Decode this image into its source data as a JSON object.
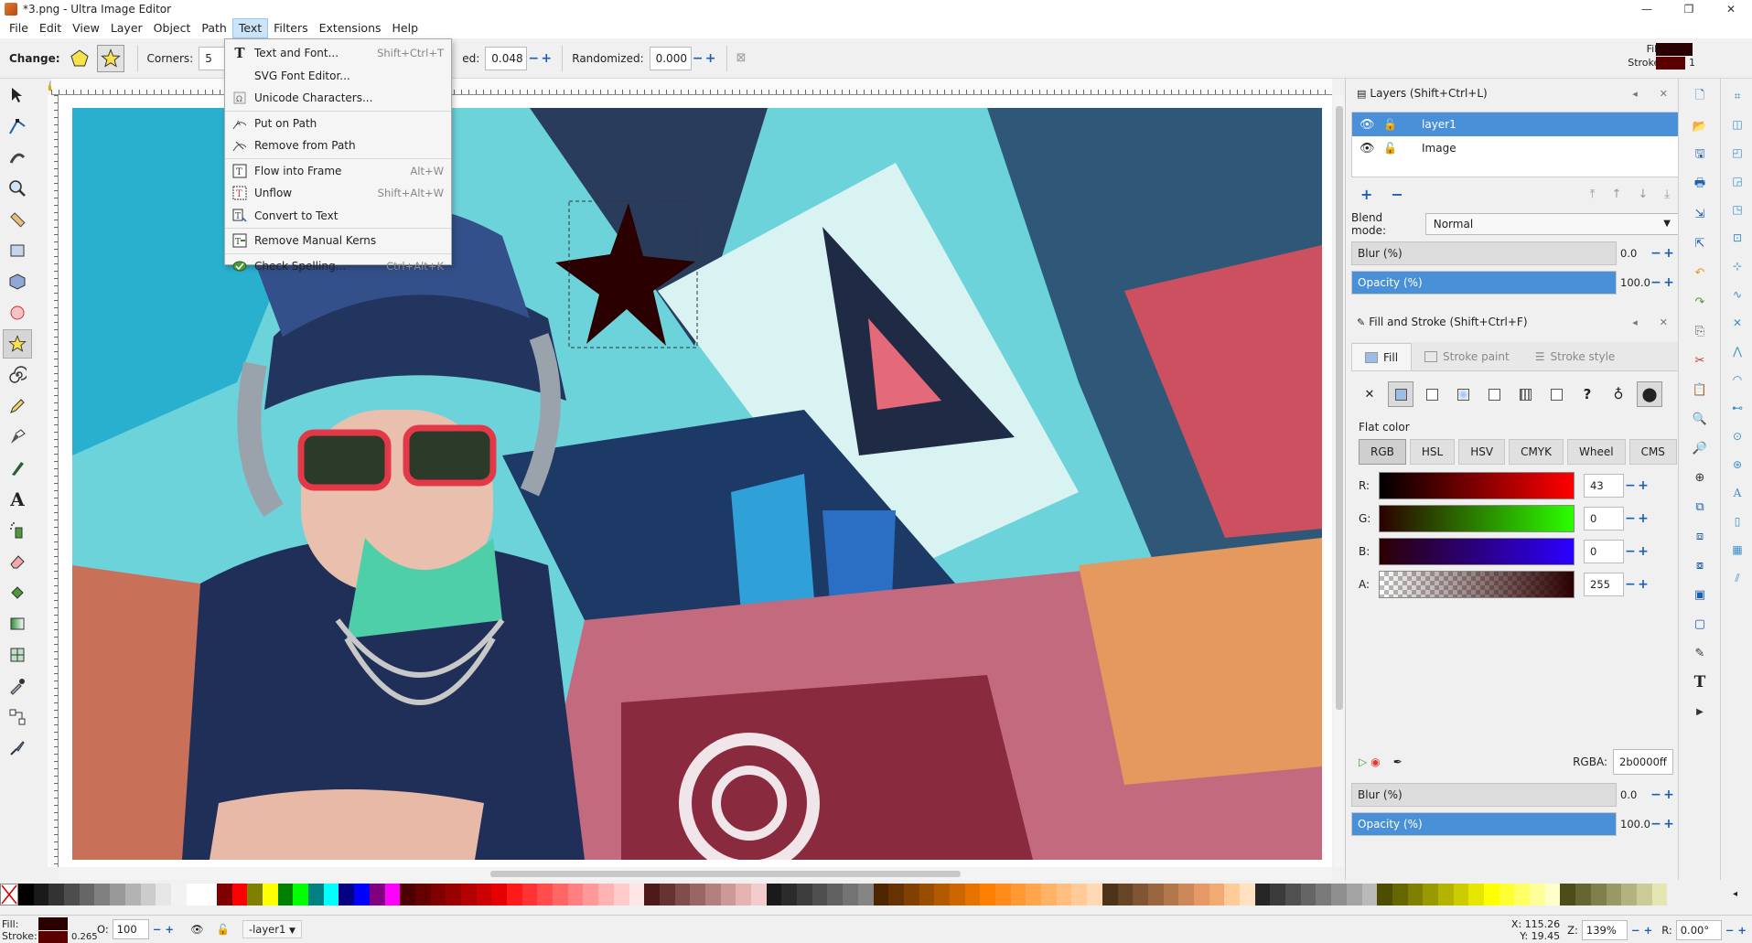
{
  "window": {
    "title": "*3.png - Ultra Image Editor",
    "min": "—",
    "max": "❐",
    "close": "✕"
  },
  "menubar": [
    "File",
    "Edit",
    "View",
    "Layer",
    "Object",
    "Path",
    "Text",
    "Filters",
    "Extensions",
    "Help"
  ],
  "controls": {
    "change_label": "Change:",
    "corners_label": "Corners:",
    "corners_value": "5",
    "rounded_label": "ed:",
    "rounded_value": "0.048",
    "randomized_label": "Randomized:",
    "randomized_value": "0.000",
    "fill_label": "Fill:",
    "stroke_label": "Stroke:",
    "stroke_value": "1"
  },
  "text_menu": [
    {
      "label": "Text and Font...",
      "shortcut": "Shift+Ctrl+T",
      "icon": "text-tool-icon"
    },
    {
      "label": "SVG Font Editor...",
      "shortcut": "",
      "icon": ""
    },
    {
      "label": "Unicode Characters...",
      "shortcut": "",
      "icon": "unicode-icon"
    },
    {
      "label": "Put on Path",
      "shortcut": "",
      "icon": "put-on-path-icon"
    },
    {
      "label": "Remove from Path",
      "shortcut": "",
      "icon": "remove-from-path-icon"
    },
    {
      "label": "Flow into Frame",
      "shortcut": "Alt+W",
      "icon": "flow-into-frame-icon"
    },
    {
      "label": "Unflow",
      "shortcut": "Shift+Alt+W",
      "icon": "unflow-icon"
    },
    {
      "label": "Convert to Text",
      "shortcut": "",
      "icon": "convert-to-text-icon"
    },
    {
      "label": "Remove Manual Kerns",
      "shortcut": "",
      "icon": "remove-kerns-icon"
    },
    {
      "label": "Check Spelling...",
      "shortcut": "Ctrl+Alt+K",
      "icon": "spellcheck-icon"
    }
  ],
  "layers_panel": {
    "title": "Layers (Shift+Ctrl+L)",
    "layers": [
      "layer1",
      "Image"
    ],
    "blend_label": "Blend mode:",
    "blend_value": "Normal",
    "blur_label": "Blur (%)",
    "blur_value": "0.0",
    "opacity_label": "Opacity (%)",
    "opacity_value": "100.0",
    "opacity_fraction": 1.0
  },
  "fill_stroke_panel": {
    "title": "Fill and Stroke (Shift+Ctrl+F)",
    "tabs": [
      "Fill",
      "Stroke paint",
      "Stroke style"
    ],
    "flat_color_label": "Flat color",
    "modes": [
      "RGB",
      "HSL",
      "HSV",
      "CMYK",
      "Wheel",
      "CMS"
    ],
    "channels": [
      {
        "label": "R:",
        "value": "43"
      },
      {
        "label": "G:",
        "value": "0"
      },
      {
        "label": "B:",
        "value": "0"
      },
      {
        "label": "A:",
        "value": "255"
      }
    ],
    "rgba_label": "RGBA:",
    "rgba_value": "2b0000ff",
    "blur_label": "Blur (%)",
    "blur_value": "0.0",
    "opacity_label": "Opacity (%)",
    "opacity_value": "100.0"
  },
  "status": {
    "fill_label": "Fill:",
    "stroke_label": "Stroke:",
    "stroke_width": "0.265",
    "opacity_label": "O:",
    "opacity_value": "100",
    "layer_value": "-layer1",
    "x_label": "X:",
    "x_value": "115.26",
    "y_label": "Y:",
    "y_value": "19.45",
    "zoom_label": "Z:",
    "zoom_value": "139%",
    "rotation_label": "R:",
    "rotation_value": "0.00°"
  },
  "colors": {
    "fill": "#2b0000",
    "stroke": "#5a0000",
    "accent": "#4a90d9"
  },
  "palette": [
    "#000000",
    "#1a1a1a",
    "#333333",
    "#4d4d4d",
    "#666666",
    "#808080",
    "#999999",
    "#b3b3b3",
    "#cccccc",
    "#e6e6e6",
    "#f2f2f2",
    "#ffffff",
    "#ffffff",
    "#800000",
    "#ff0000",
    "#808000",
    "#ffff00",
    "#008000",
    "#00ff00",
    "#008080",
    "#00ffff",
    "#000080",
    "#0000ff",
    "#800080",
    "#ff00ff",
    "#4d0000",
    "#660000",
    "#800000",
    "#990000",
    "#b30000",
    "#cc0000",
    "#e60000",
    "#ff1a1a",
    "#ff3333",
    "#ff4d4d",
    "#ff6666",
    "#ff8080",
    "#ff9999",
    "#ffb3b3",
    "#ffcccc",
    "#ffe6e6",
    "#4d1a1a",
    "#663333",
    "#804d4d",
    "#996666",
    "#b38080",
    "#cc9999",
    "#e6b3b3",
    "#f2cccc",
    "#1a1a1a",
    "#2b2b2b",
    "#3d3d3d",
    "#4f4f4f",
    "#616161",
    "#737373",
    "#858585",
    "#4d2600",
    "#663300",
    "#804000",
    "#994d00",
    "#b35900",
    "#cc6600",
    "#e67300",
    "#ff8000",
    "#ff8c1a",
    "#ff9933",
    "#ffa64d",
    "#ffb366",
    "#ffbf80",
    "#ffcc99",
    "#ffd9b3",
    "#4d3319",
    "#664426",
    "#805533",
    "#996640",
    "#b3774d",
    "#cc8859",
    "#e69966",
    "#f2aa73",
    "#ffcc99",
    "#ffe0c2",
    "#262626",
    "#3b3b3b",
    "#505050",
    "#656565",
    "#7a7a7a",
    "#8f8f8f",
    "#a4a4a4",
    "#b9b9b9",
    "#4d4d00",
    "#666600",
    "#808000",
    "#999900",
    "#b3b300",
    "#cccc00",
    "#e6e600",
    "#ffff00",
    "#ffff33",
    "#ffff66",
    "#ffff99",
    "#ffffcc",
    "#4d4d1a",
    "#666633",
    "#80804d",
    "#999966",
    "#b3b380",
    "#cccc99",
    "#e6e6b3"
  ]
}
